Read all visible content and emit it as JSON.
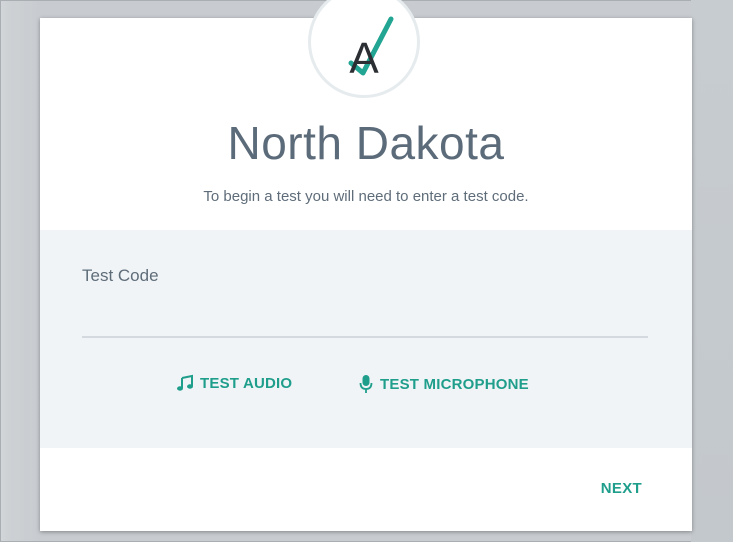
{
  "login": {
    "logo_letter": "A",
    "state_name": "North Dakota",
    "instructions": "To begin a test you will need to enter a test code.",
    "test_code_label": "Test Code",
    "test_code_value": "",
    "test_audio_label": "TEST AUDIO",
    "test_microphone_label": "TEST MICROPHONE",
    "next_label": "NEXT"
  },
  "icons": {
    "logo": "airlocks-logo-icon",
    "audio": "music-note-icon",
    "microphone": "microphone-icon"
  },
  "colors": {
    "accent": "#1f9e8c",
    "title_text": "#5c6b7a",
    "panel_background": "#f1f4f6",
    "page_background": "#c9ced2"
  }
}
